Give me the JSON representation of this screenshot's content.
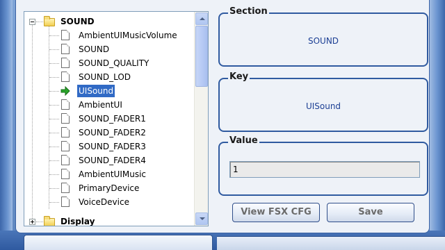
{
  "tree": {
    "items": [
      {
        "label": "SOUND",
        "kind": "folder",
        "expanded": true,
        "bold": true,
        "level": 0
      },
      {
        "label": "AmbientUIMusicVolume",
        "kind": "doc",
        "level": 1
      },
      {
        "label": "SOUND",
        "kind": "doc",
        "level": 1
      },
      {
        "label": "SOUND_QUALITY",
        "kind": "doc",
        "level": 1
      },
      {
        "label": "SOUND_LOD",
        "kind": "doc",
        "level": 1
      },
      {
        "label": "UISound",
        "kind": "arrow",
        "level": 1,
        "selected": true
      },
      {
        "label": "AmbientUI",
        "kind": "doc",
        "level": 1
      },
      {
        "label": "SOUND_FADER1",
        "kind": "doc",
        "level": 1
      },
      {
        "label": "SOUND_FADER2",
        "kind": "doc",
        "level": 1
      },
      {
        "label": "SOUND_FADER3",
        "kind": "doc",
        "level": 1
      },
      {
        "label": "SOUND_FADER4",
        "kind": "doc",
        "level": 1
      },
      {
        "label": "AmbientUIMusic",
        "kind": "doc",
        "level": 1
      },
      {
        "label": "PrimaryDevice",
        "kind": "doc",
        "level": 1
      },
      {
        "label": "VoiceDevice",
        "kind": "doc",
        "level": 1
      },
      {
        "label": "Display",
        "kind": "folder",
        "expanded": false,
        "bold": true,
        "level": 0
      }
    ]
  },
  "section": {
    "title": "Section",
    "value": "SOUND"
  },
  "key": {
    "title": "Key",
    "value": "UISound"
  },
  "value": {
    "title": "Value",
    "input_value": "1"
  },
  "buttons": {
    "view": "View FSX CFG",
    "save": "Save"
  },
  "colors": {
    "accent": "#2f5aa0",
    "selection": "#316ac5",
    "value_text": "#1c3f94"
  }
}
